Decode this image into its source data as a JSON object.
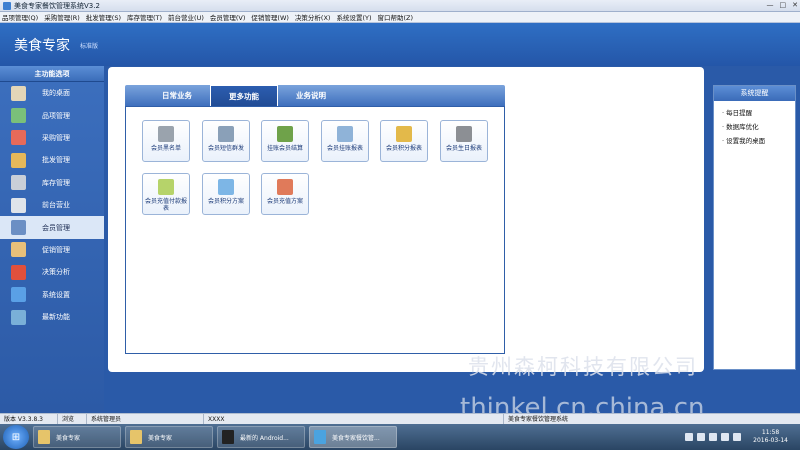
{
  "window": {
    "title": "美食专家餐饮管理系统V3.2",
    "buttons": [
      "—",
      "□",
      "✕"
    ]
  },
  "menu": [
    "品项管理(Q)",
    "采购管理(R)",
    "批发管理(S)",
    "库存管理(T)",
    "前台营业(U)",
    "会员管理(V)",
    "促销管理(W)",
    "决策分析(X)",
    "系统设置(Y)",
    "窗口帮助(Z)"
  ],
  "header": {
    "brand": "美食专家",
    "edition": "标准版"
  },
  "sidebar": {
    "title": "主功能选项",
    "items": [
      {
        "label": "我的桌面",
        "icon": "house-icon",
        "color": "#e3d6b8"
      },
      {
        "label": "品项管理",
        "icon": "item-icon",
        "color": "#7ac07a"
      },
      {
        "label": "采购管理",
        "icon": "purchase-icon",
        "color": "#e66a5a"
      },
      {
        "label": "批发管理",
        "icon": "wholesale-icon",
        "color": "#e6b85a"
      },
      {
        "label": "库存管理",
        "icon": "inventory-icon",
        "color": "#c9cfd8"
      },
      {
        "label": "前台营业",
        "icon": "cart-icon",
        "color": "#dfe4ea"
      },
      {
        "label": "会员管理",
        "icon": "members-icon",
        "color": "#6b8fc4",
        "active": true
      },
      {
        "label": "促销管理",
        "icon": "promotion-chart-icon",
        "color": "#e8c07a"
      },
      {
        "label": "决策分析",
        "icon": "analysis-chart-icon",
        "color": "#e0503c"
      },
      {
        "label": "系统设置",
        "icon": "settings-icon",
        "color": "#5aa0e6"
      },
      {
        "label": "最新功能",
        "icon": "new-feature-icon",
        "color": "#7ab0d8"
      }
    ]
  },
  "tabs": [
    {
      "label": "日常业务",
      "active": false
    },
    {
      "label": "更多功能",
      "active": true
    },
    {
      "label": "业务说明",
      "active": false
    }
  ],
  "functions": [
    {
      "label": "会员黑名单",
      "icon": "blacklist-icon",
      "color": "#9aa3ad"
    },
    {
      "label": "会员短信群发",
      "icon": "sms-icon",
      "color": "#8aa0b8"
    },
    {
      "label": "挂账会员结算",
      "icon": "settlement-icon",
      "color": "#6fa24a"
    },
    {
      "label": "会员挂账报表",
      "icon": "credit-report-icon",
      "color": "#8fb3d8"
    },
    {
      "label": "会员积分报表",
      "icon": "points-report-icon",
      "color": "#e3b94a"
    },
    {
      "label": "会员生日报表",
      "icon": "birthday-report-icon",
      "color": "#8c8f94"
    },
    {
      "label": "会员充值付款报表",
      "icon": "recharge-report-icon",
      "color": "#b6d36a"
    },
    {
      "label": "会员积分方案",
      "icon": "points-plan-icon",
      "color": "#7db6e6"
    },
    {
      "label": "会员充值方案",
      "icon": "recharge-plan-icon",
      "color": "#e07a5a"
    }
  ],
  "system_panel": {
    "title": "系统提醒",
    "items": [
      "· 每日提醒",
      "· 数据库优化",
      "· 设置我的桌面"
    ]
  },
  "watermark": {
    "line1": "贵州森柯科技有限公司",
    "line2": "thinkel.cn.china.cn"
  },
  "statusbar": {
    "version": "版本 V3.3.8.3",
    "mode": "浏览",
    "user": "系统管理员",
    "code": "XXXX",
    "app": "美食专家餐饮管理系统"
  },
  "taskbar": {
    "buttons": [
      {
        "label": "美食专家",
        "icon": "folder-icon",
        "color": "#e6c46a"
      },
      {
        "label": "美食专家",
        "icon": "folder-icon",
        "color": "#e6c46a"
      },
      {
        "label": "最新的 Android...",
        "icon": "qq-icon",
        "color": "#222"
      },
      {
        "label": "美食专家餐饮管...",
        "icon": "monitor-icon",
        "color": "#4aa3e0"
      }
    ],
    "time": "11:58",
    "date": "2016-03-14"
  }
}
